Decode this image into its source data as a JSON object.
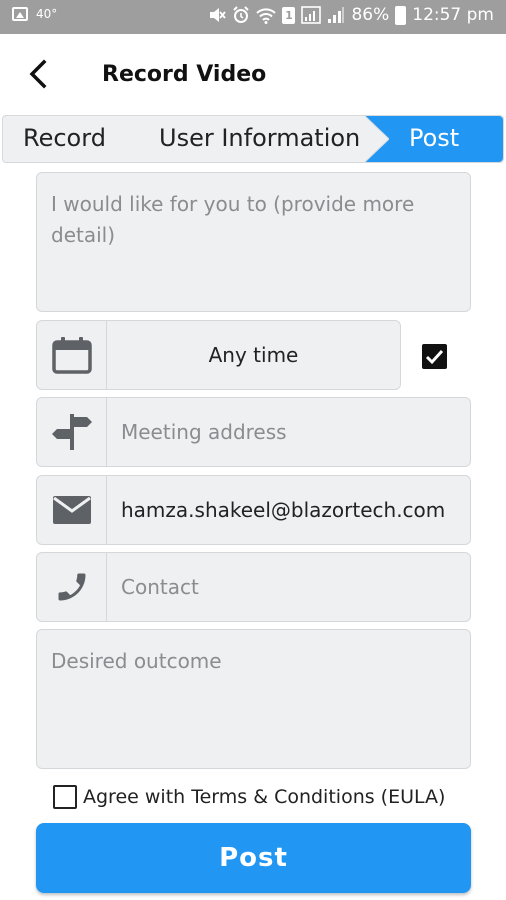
{
  "status_bar": {
    "temperature": "40°",
    "battery": "86%",
    "time": "12:57 pm",
    "sim_label": "1",
    "background": "#9e9e9e"
  },
  "header": {
    "title": "Record Video"
  },
  "stepper": {
    "steps": [
      {
        "label": "Record",
        "active": false
      },
      {
        "label": "User Information",
        "active": false
      },
      {
        "label": "Post",
        "active": true
      }
    ],
    "active_color": "#2196f3"
  },
  "form": {
    "detail_placeholder": "I would like for you to (provide more detail)",
    "time_value": "Any time",
    "time_checked": true,
    "address_placeholder": "Meeting address",
    "email_value": "hamza.shakeel@blazortech.com",
    "contact_placeholder": "Contact",
    "outcome_placeholder": "Desired outcome",
    "terms_label": "Agree with Terms & Conditions (EULA)",
    "terms_checked": false
  },
  "submit": {
    "label": "Post",
    "color": "#2196f3"
  }
}
